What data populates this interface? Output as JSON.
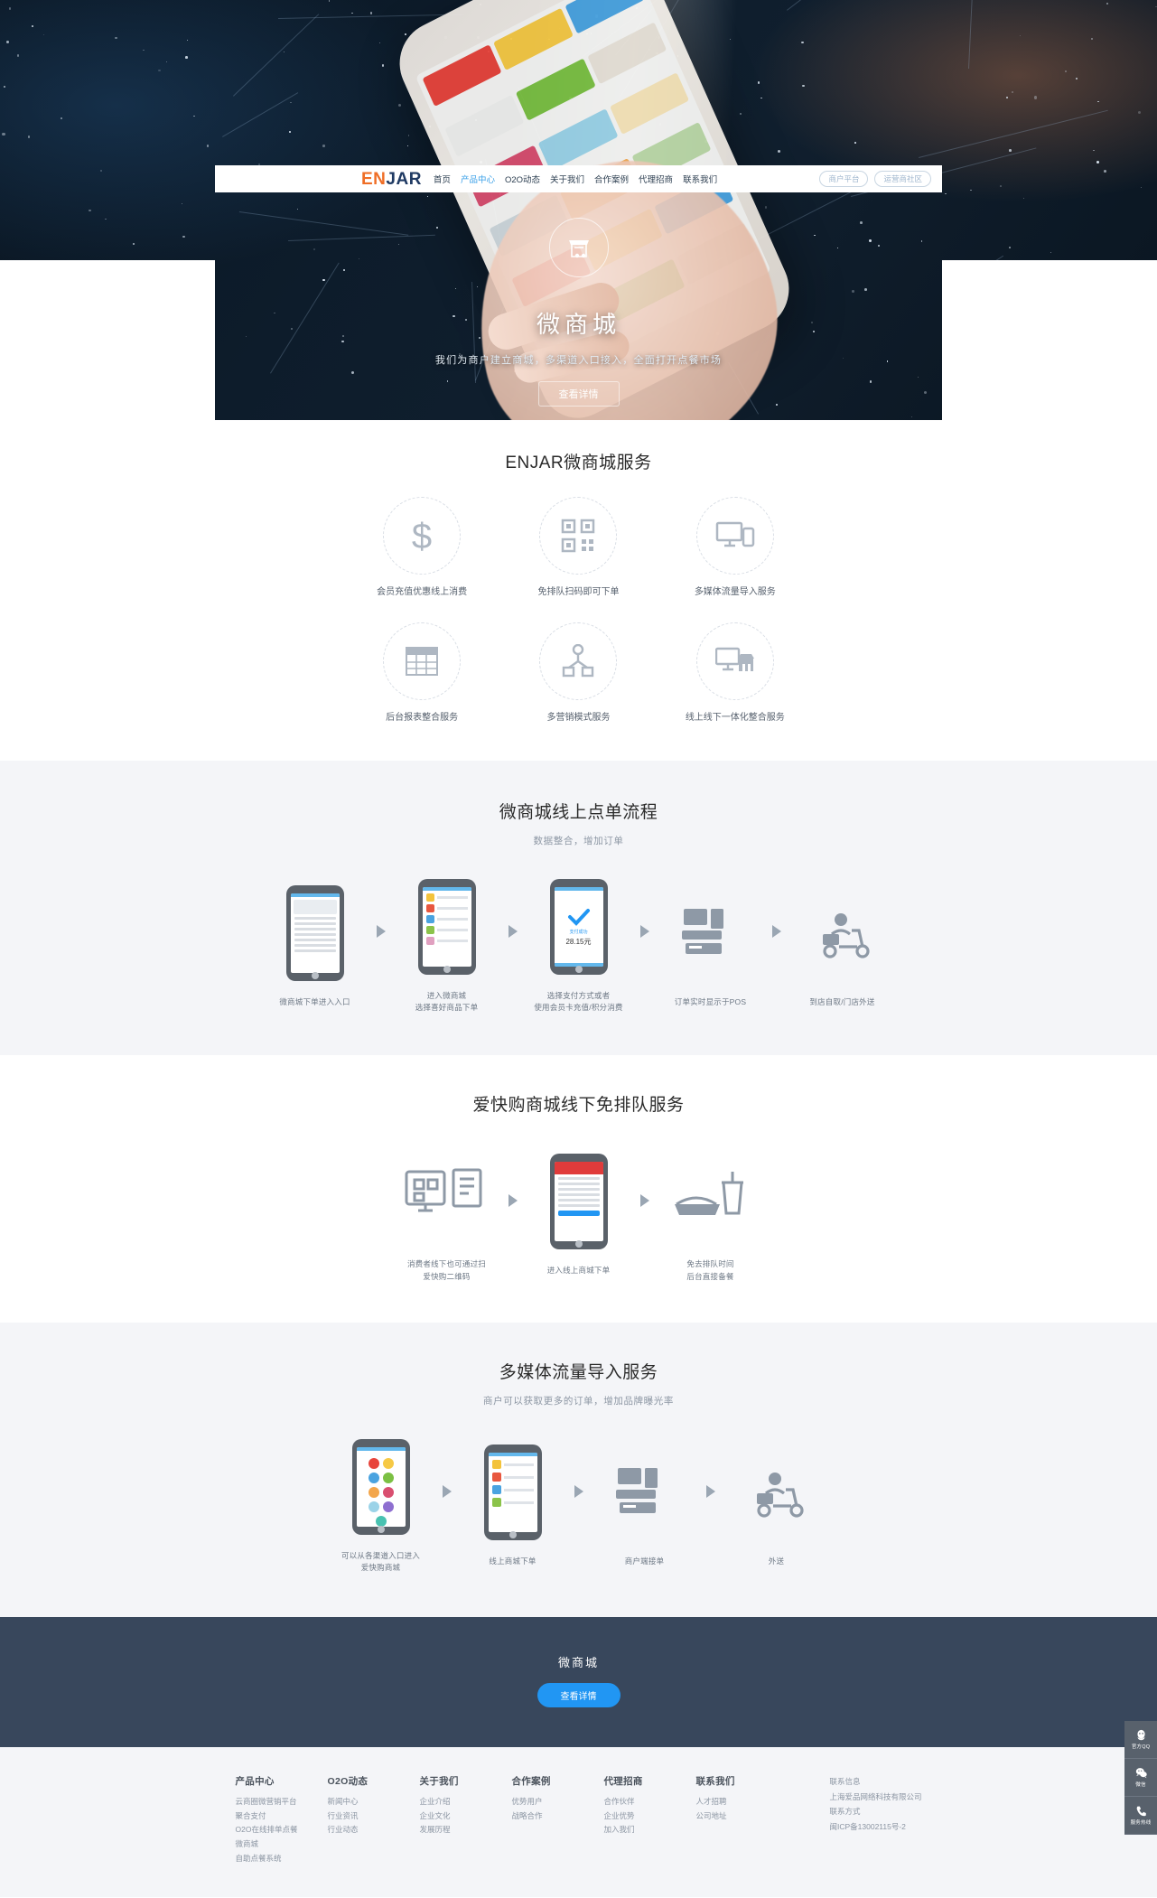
{
  "nav": {
    "logo_en": "EN",
    "logo_jar": "JAR",
    "items": [
      {
        "label": "首页"
      },
      {
        "label": "产品中心"
      },
      {
        "label": "O2O动态"
      },
      {
        "label": "关于我们"
      },
      {
        "label": "合作案例"
      },
      {
        "label": "代理招商"
      },
      {
        "label": "联系我们"
      }
    ],
    "buttons": [
      {
        "label": "商户平台"
      },
      {
        "label": "运营商社区"
      }
    ]
  },
  "hero": {
    "icon": "store-cart-icon",
    "title": "微商城",
    "subtitle": "我们为商户建立商城，多渠道入口接入，全面打开点餐市场",
    "cta": "查看详情"
  },
  "services": {
    "title": "ENJAR微商城服务",
    "items": [
      {
        "icon": "dollar-icon",
        "label": "会员充值优惠线上消费"
      },
      {
        "icon": "qrcode-icon",
        "label": "免排队扫码即可下单"
      },
      {
        "icon": "multi-device-icon",
        "label": "多媒体流量导入服务"
      },
      {
        "icon": "report-table-icon",
        "label": "后台报表整合服务"
      },
      {
        "icon": "network-node-icon",
        "label": "多营销模式服务"
      },
      {
        "icon": "online-offline-icon",
        "label": "线上线下一体化整合服务"
      }
    ]
  },
  "flow_online": {
    "title": "微商城线上点单流程",
    "subtitle": "数据整合，增加订单",
    "steps": [
      {
        "icon": "phone-entry-icon",
        "caption": "微商城下单进入入口"
      },
      {
        "icon": "phone-menu-icon",
        "caption": "进入微商城\n选择喜好商品下单"
      },
      {
        "icon": "phone-pay-icon",
        "caption": "选择支付方式或者\n使用会员卡充值/积分消费",
        "pay_status": "支付成功",
        "pay_amount": "28.15元"
      },
      {
        "icon": "pos-terminal-icon",
        "caption": "订单实时显示于POS"
      },
      {
        "icon": "delivery-scooter-icon",
        "caption": "到店自取/门店外送"
      }
    ]
  },
  "flow_offline": {
    "title": "爱快购商城线下免排队服务",
    "steps": [
      {
        "icon": "qr-scan-doc-icon",
        "caption": "消费者线下也可通过扫\n爱快购二维码"
      },
      {
        "icon": "phone-order-icon",
        "caption": "进入线上商城下单"
      },
      {
        "icon": "drink-tray-icon",
        "caption": "免去排队时间\n后台直接备餐"
      }
    ]
  },
  "flow_media": {
    "title": "多媒体流量导入服务",
    "subtitle": "商户可以获取更多的订单，增加品牌曝光率",
    "steps": [
      {
        "icon": "phone-apps-icon",
        "caption": "可以从各渠道入口进入\n爱快购商城"
      },
      {
        "icon": "phone-cart-icon",
        "caption": "线上商城下单"
      },
      {
        "icon": "pos-terminal-icon",
        "caption": "商户端接单"
      },
      {
        "icon": "delivery-scooter-icon",
        "caption": "外送"
      }
    ]
  },
  "cta": {
    "title": "微商城",
    "button": "查看详情"
  },
  "footer": {
    "columns": [
      {
        "title": "产品中心",
        "links": [
          "云商圈微营销平台",
          "聚合支付",
          "O2O在线排单点餐",
          "微商城",
          "自助点餐系统"
        ]
      },
      {
        "title": "O2O动态",
        "links": [
          "新闻中心",
          "行业资讯",
          "行业动态"
        ]
      },
      {
        "title": "关于我们",
        "links": [
          "企业介绍",
          "企业文化",
          "发展历程"
        ]
      },
      {
        "title": "合作案例",
        "links": [
          "优势用户",
          "战略合作"
        ]
      },
      {
        "title": "代理招商",
        "links": [
          "合作伙伴",
          "企业优势",
          "加入我们"
        ]
      },
      {
        "title": "联系我们",
        "links": [
          "人才招聘",
          "公司地址"
        ]
      }
    ],
    "contact": [
      "联系信息",
      "上海爱品网络科技有限公司",
      "联系方式",
      "闽ICP备13002115号-2"
    ]
  },
  "side_widgets": [
    {
      "icon": "qq-icon",
      "label": "官方QQ"
    },
    {
      "icon": "wechat-icon",
      "label": "微信"
    },
    {
      "icon": "phone-icon",
      "label": "服务热线"
    }
  ],
  "colors": {
    "brand_orange": "#ef6e26",
    "brand_navy": "#1f3a63",
    "accent_blue": "#2196f3",
    "cta_band": "#38475c",
    "section_grey": "#f4f5f8"
  }
}
